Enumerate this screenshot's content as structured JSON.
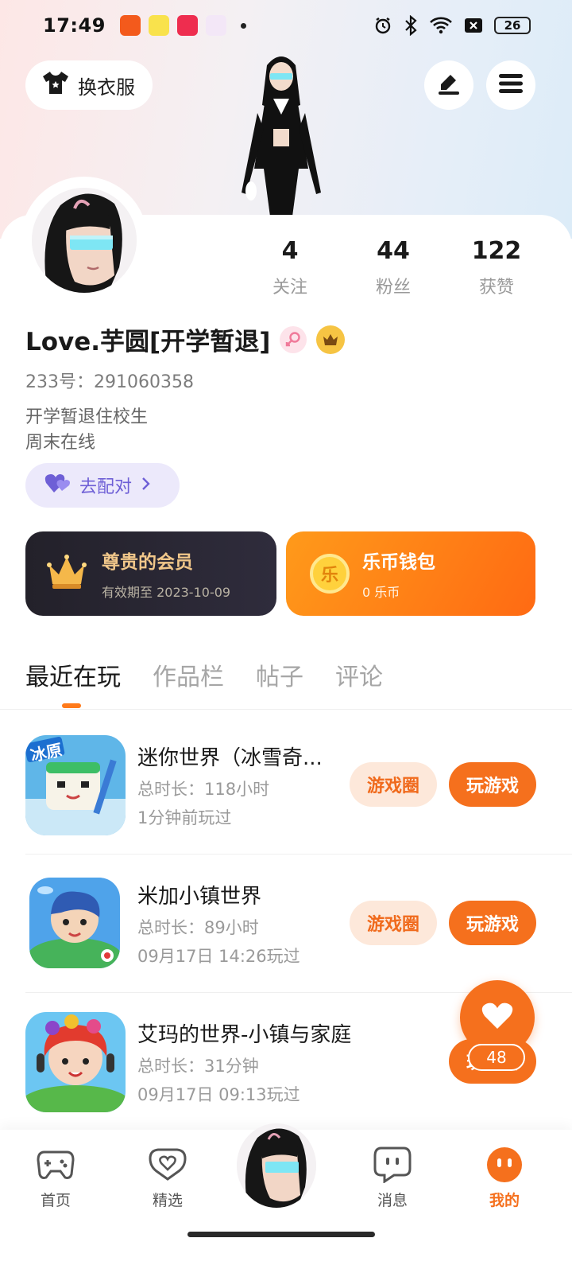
{
  "status_bar": {
    "time": "17:49",
    "battery": "26"
  },
  "header": {
    "dressup_label": "换衣服"
  },
  "profile": {
    "username": "Love.芋圆[开学暂退]",
    "user_id": "233号：291060358",
    "bio_line1": "开学暂退住校生",
    "bio_line2": "周末在线",
    "match_label": "去配对",
    "stats": [
      {
        "num": "4",
        "label": "关注"
      },
      {
        "num": "44",
        "label": "粉丝"
      },
      {
        "num": "122",
        "label": "获赞"
      }
    ]
  },
  "cards": {
    "vip_title": "尊贵的会员",
    "vip_sub": "有效期至 2023-10-09",
    "wallet_title": "乐币钱包",
    "wallet_sub": "0 乐币",
    "coin_glyph": "乐"
  },
  "tabs": [
    {
      "label": "最近在玩",
      "active": true
    },
    {
      "label": "作品栏",
      "active": false
    },
    {
      "label": "帖子",
      "active": false
    },
    {
      "label": "评论",
      "active": false
    }
  ],
  "games": [
    {
      "name": "迷你世界（冰雪奇...",
      "duration": "总时长：118小时",
      "last_played": "1分钟前玩过",
      "circle_label": "游戏圈",
      "play_label": "玩游戏",
      "icon_banner": "冰原"
    },
    {
      "name": "米加小镇世界",
      "duration": "总时长：89小时",
      "last_played": "09月17日 14:26玩过",
      "circle_label": "游戏圈",
      "play_label": "玩游戏"
    },
    {
      "name": "艾玛的世界-小镇与家庭",
      "duration": "总时长：31分钟",
      "last_played": "09月17日 09:13玩过",
      "play_label": "玩游戏"
    }
  ],
  "like_fab": {
    "count": "48"
  },
  "bottom_nav": [
    {
      "label": "首页",
      "icon": "gamepad-icon"
    },
    {
      "label": "精选",
      "icon": "heart-bubble-icon"
    },
    {
      "label": "消息",
      "icon": "chat-icon"
    },
    {
      "label": "我的",
      "icon": "face-icon",
      "active": true
    }
  ],
  "colors": {
    "accent": "#f5701d",
    "vip_gold": "#f1c78a",
    "match_purple": "#6e5fd6"
  }
}
